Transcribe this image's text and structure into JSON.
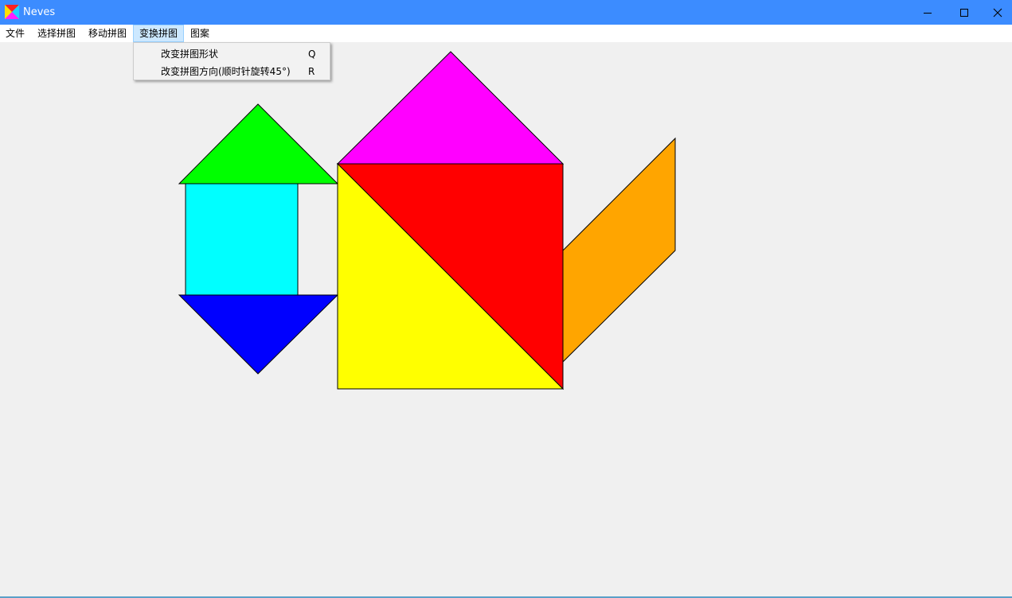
{
  "window": {
    "title": "Neves",
    "app_icon": "tangram-app-icon",
    "controls": {
      "minimize": "minimize-icon",
      "maximize": "maximize-icon",
      "close": "close-icon"
    }
  },
  "menubar": {
    "items": [
      {
        "label": "文件"
      },
      {
        "label": "选择拼图"
      },
      {
        "label": "移动拼图"
      },
      {
        "label": "变换拼图",
        "active": true
      },
      {
        "label": "图案"
      }
    ]
  },
  "dropdown": {
    "items": [
      {
        "label": "改变拼图形状",
        "shortcut": "Q"
      },
      {
        "label": "改变拼图方向(顺时针旋转45°)",
        "shortcut": "R"
      }
    ]
  },
  "colors": {
    "titlebar": "#3c8cff",
    "menu_active": "#cce8ff",
    "canvas": "#f0f0f0",
    "piece_green": "#00ff00",
    "piece_cyan": "#00ffff",
    "piece_blue": "#0000ff",
    "piece_magenta": "#ff00ff",
    "piece_red": "#ff0000",
    "piece_yellow": "#ffff00",
    "piece_orange": "#ffa500"
  }
}
